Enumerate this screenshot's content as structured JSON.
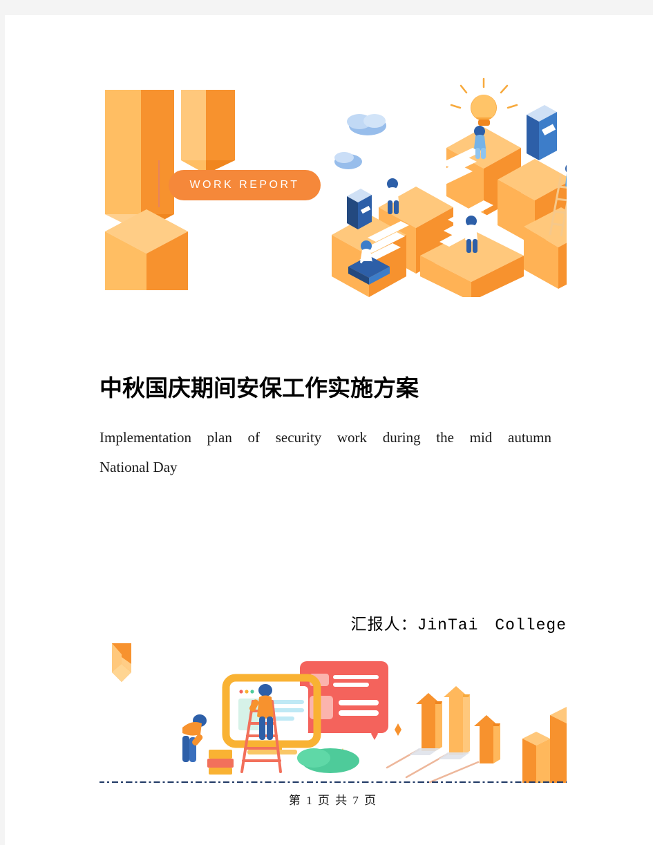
{
  "document": {
    "badge_label": "WORK REPORT",
    "title_cn": "中秋国庆期间安保工作实施方案",
    "subtitle_en_line1": "Implementation plan of security work during the mid autumn",
    "subtitle_en_line2": "National Day",
    "reporter_label": "汇报人：JinTai　College",
    "page_number_text": "第 1 页 共 7 页"
  },
  "colors": {
    "orange_primary": "#f5883a",
    "orange_light": "#ffb85c",
    "orange_lighter": "#ffc978",
    "orange_dark": "#f47b20",
    "blue_dark": "#1f3864",
    "blue_book": "#2d5fa8",
    "blue_light_cloud": "#a8c8f0",
    "red_card": "#f4635c",
    "green_bush": "#4ecb9a",
    "page_background": "#ffffff",
    "canvas_background": "#f4f4f4"
  },
  "illustrations": {
    "header": {
      "name": "isometric-work-report-illustration",
      "elements": [
        "orange-cubes",
        "work-report-badge",
        "isometric-steps",
        "people",
        "books",
        "clouds",
        "lightbulb",
        "ladder"
      ]
    },
    "footer": {
      "name": "teamwork-dashboard-illustration",
      "elements": [
        "orange-shield-cube",
        "monitor-window",
        "red-card",
        "ladder-person",
        "boxes-person",
        "green-bush",
        "up-arrows",
        "bar-blocks",
        "sparkles"
      ]
    }
  }
}
